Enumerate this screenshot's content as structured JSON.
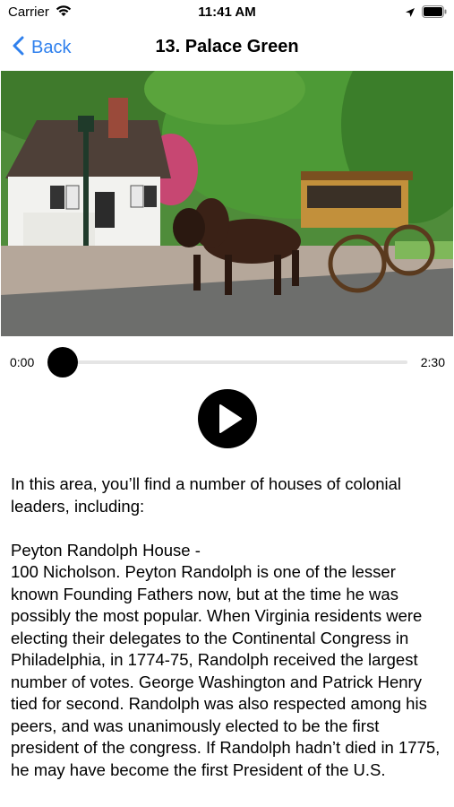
{
  "status_bar": {
    "carrier": "Carrier",
    "time": "11:41 AM"
  },
  "nav": {
    "back_label": "Back",
    "title": "13. Palace Green"
  },
  "audio": {
    "current_time": "0:00",
    "duration": "2:30",
    "progress": 0
  },
  "description": {
    "para1": "In this area, you’ll find a number of houses of colonial leaders, including:",
    "para2_heading": "Peyton Randolph House -",
    "para2_body": "100 Nicholson. Peyton Randolph is one of the lesser known Founding Fathers now, but at the time he was possibly the most popular. When Virginia residents were electing their delegates to the Continental Congress in Philadelphia, in 1774-75, Randolph received the largest number of votes. George Washington and Patrick Henry tied for second. Randolph was also respected among his peers, and was unanimously elected to be the first president of the congress. If Randolph hadn’t died in 1775, he may have become the first President of the U.S."
  }
}
